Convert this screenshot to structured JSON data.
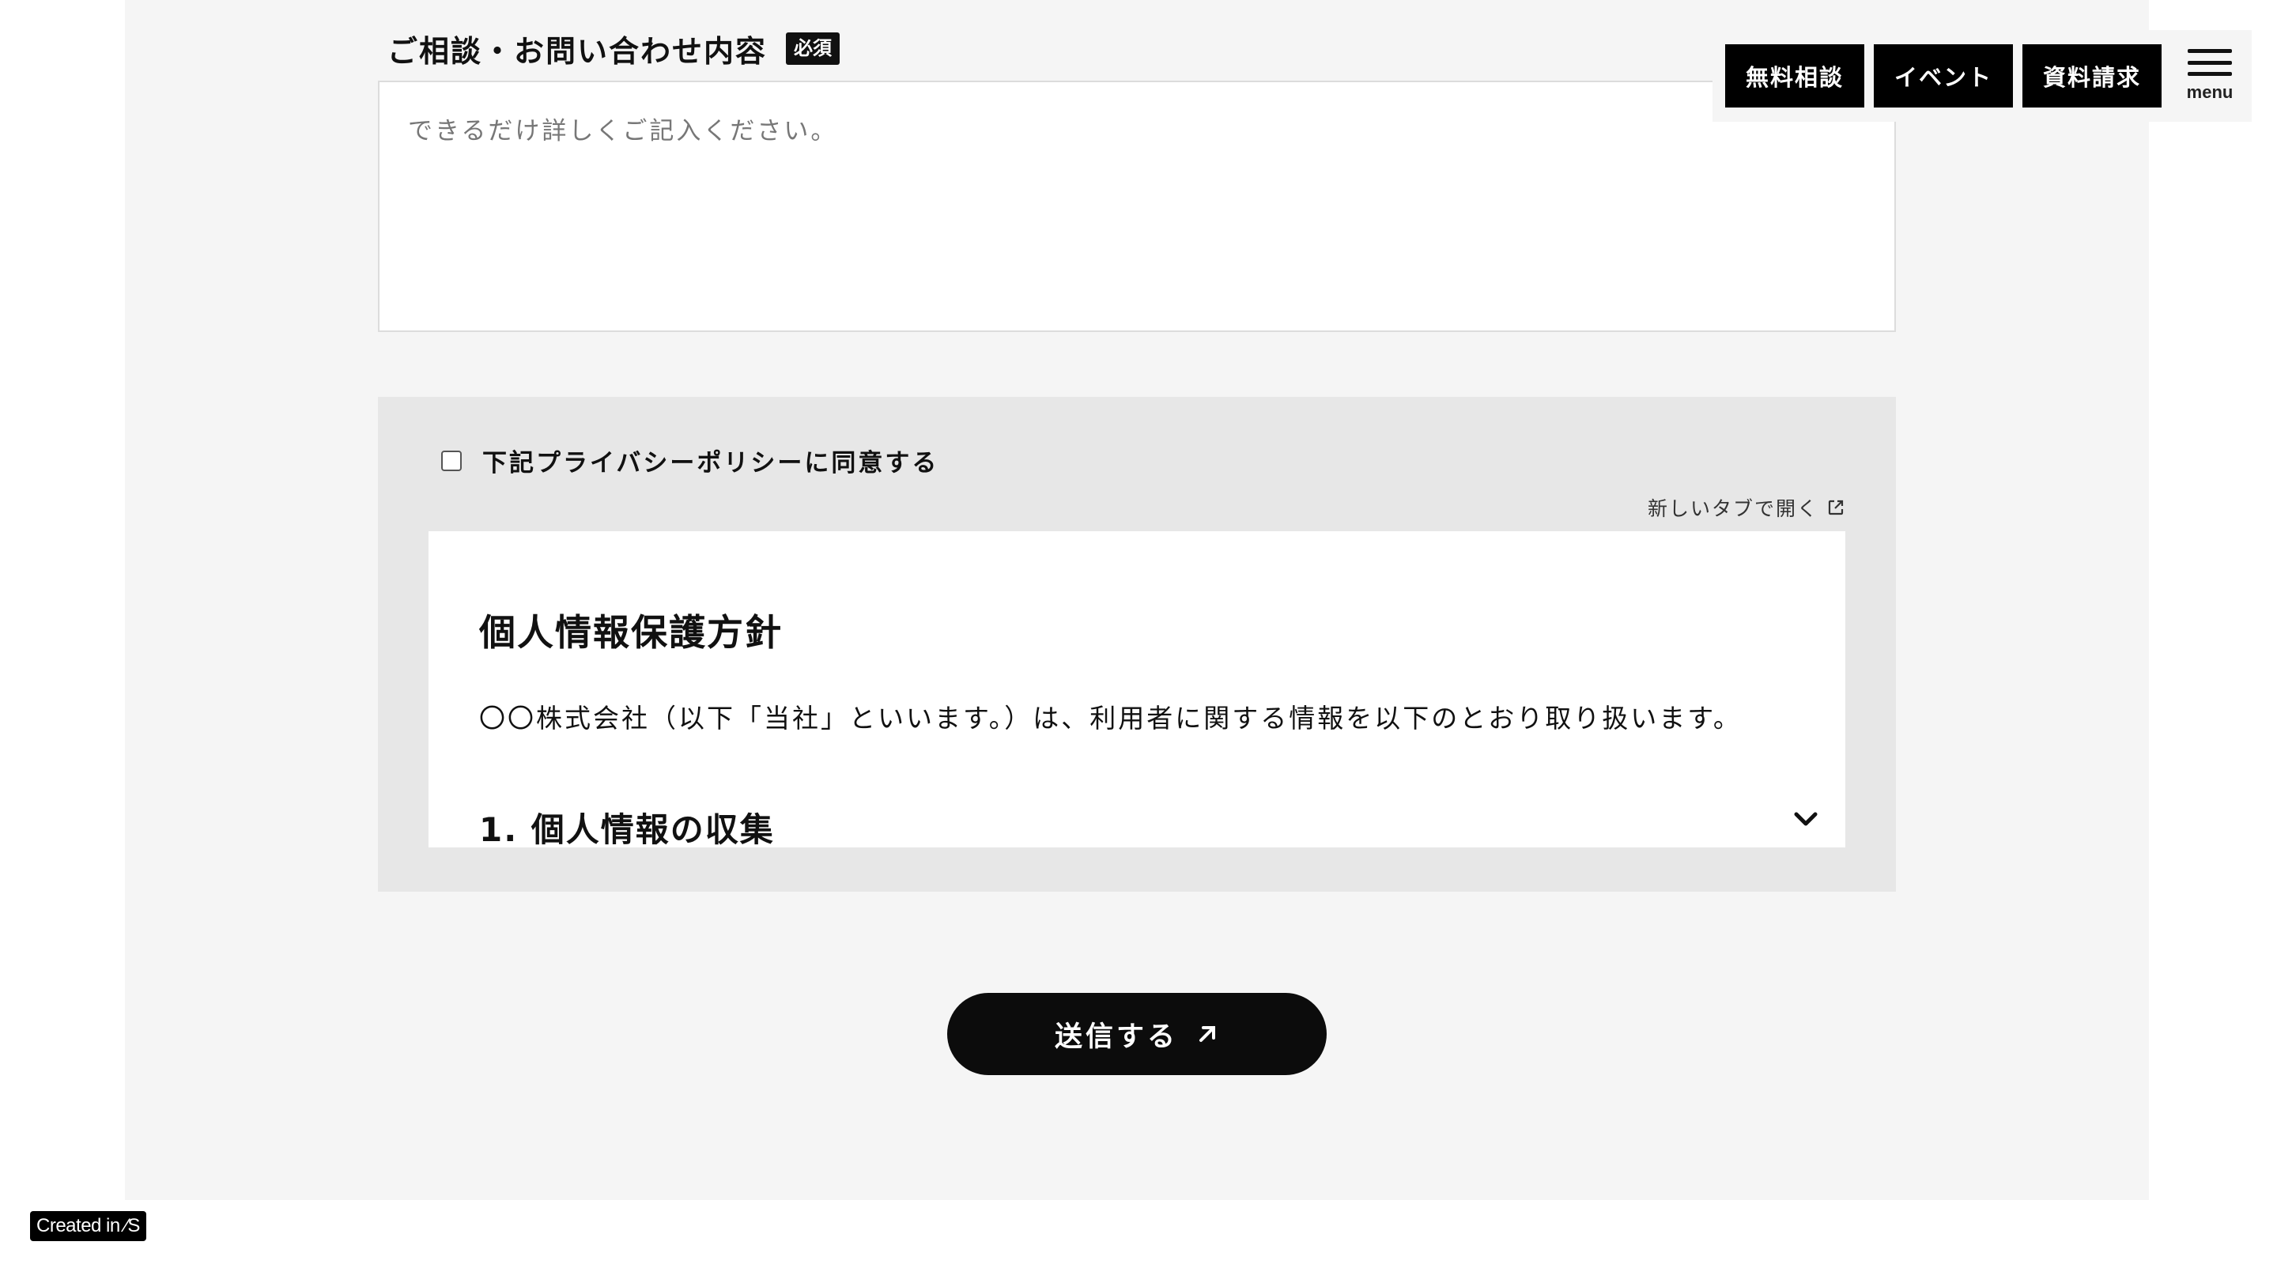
{
  "form": {
    "inquiry_label": "ご相談・お問い合わせ内容",
    "required_badge": "必須",
    "message_placeholder": "できるだけ詳しくご記入ください。",
    "message_value": ""
  },
  "privacy": {
    "agree_label": "下記プライバシーポリシーに同意する",
    "agree_checked": false,
    "open_new_tab_label": "新しいタブで開く",
    "policy_title": "個人情報保護方針",
    "policy_intro": "〇〇株式会社（以下「当社」といいます。）は、利用者に関する情報を以下のとおり取り扱います。",
    "section_1_heading": "1. 個人情報の収集",
    "expand_icon": "chevron-down-icon"
  },
  "submit": {
    "label": "送信する",
    "icon": "arrow-up-right-icon"
  },
  "header": {
    "nav": [
      "無料相談",
      "イベント",
      "資料請求"
    ],
    "menu_label": "menu",
    "menu_icon": "hamburger-icon"
  },
  "badge": {
    "created_in": "Created in ⁄S"
  },
  "colors": {
    "page_background": "#f5f5f5",
    "privacy_background": "#e7e7e7",
    "button_black": "#0c0c0c"
  }
}
